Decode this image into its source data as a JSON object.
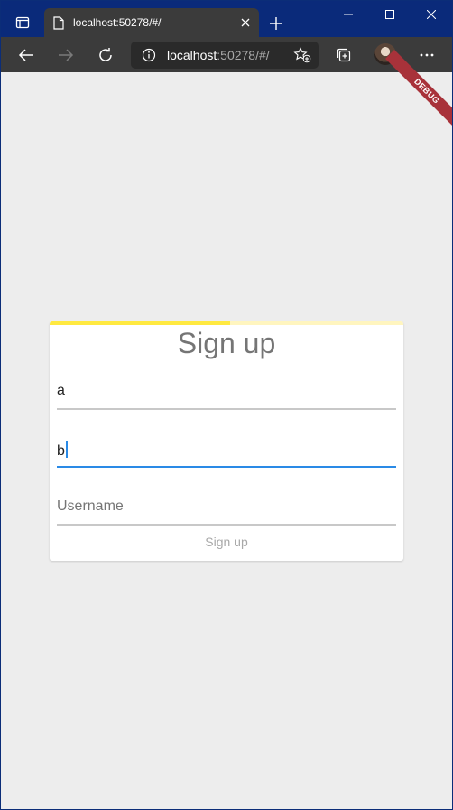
{
  "browser": {
    "tab_title": "localhost:50278/#/",
    "address_host": "localhost",
    "address_path": ":50278/#/"
  },
  "app": {
    "debug_banner": "DEBUG"
  },
  "signup_form": {
    "title": "Sign up",
    "progress": 0.51,
    "field1_value": "a",
    "field2_value": "b",
    "username_placeholder": "Username",
    "submit_label": "Sign up"
  },
  "colors": {
    "progress_fill": "#ffe940",
    "progress_track": "#fff5bf",
    "focus_accent": "#2a8ae6",
    "debug_banner": "#a8323a"
  }
}
